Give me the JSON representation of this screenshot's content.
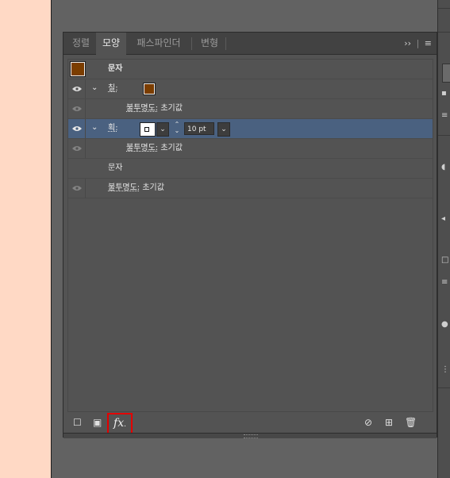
{
  "panel": {
    "tabs": [
      {
        "label": "정렬",
        "active": false
      },
      {
        "label": "모양",
        "active": true
      },
      {
        "label": "패스파인더",
        "active": false
      },
      {
        "label": "변형",
        "active": false
      }
    ],
    "overflow_icon": "double-chevron-right",
    "menu_icon": "hamburger"
  },
  "colors": {
    "fill": "#7b3d00",
    "selection": "#4a6180",
    "highlight_box": "#e30000"
  },
  "appearance": {
    "header_label": "문자",
    "fill_label": "칠:",
    "fill_opacity_label": "불투명도:",
    "fill_opacity_value": "초기값",
    "stroke_label": "획:",
    "stroke_weight": "10 pt",
    "stroke_opacity_label": "불투명도:",
    "stroke_opacity_value": "초기값",
    "characters_label": "문자",
    "opacity_label": "불투명도:",
    "opacity_value": "초기값"
  },
  "bottom": {
    "fx_label": "fx"
  }
}
